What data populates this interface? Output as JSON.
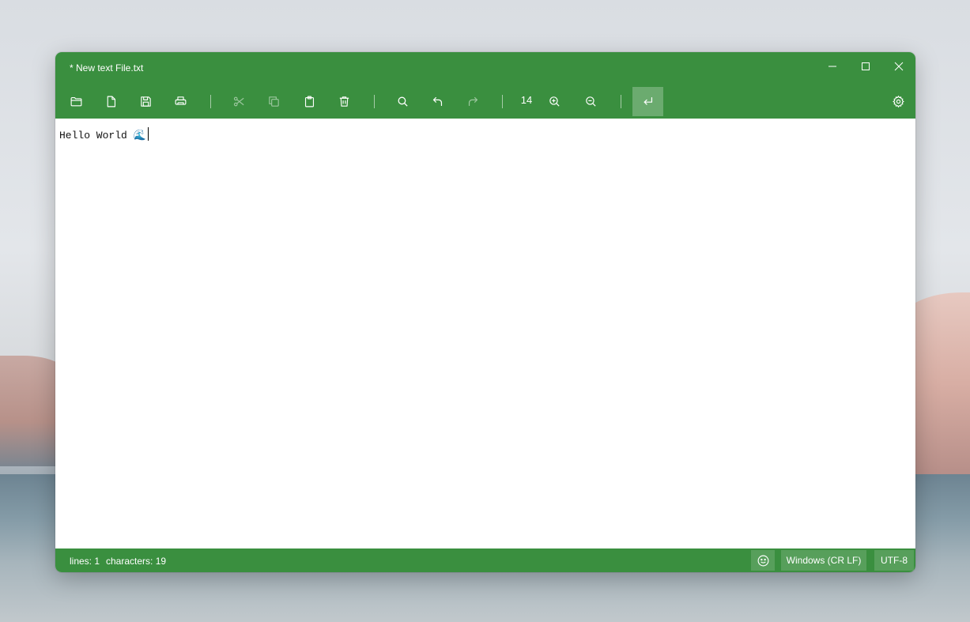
{
  "window": {
    "title": "* New text File.txt"
  },
  "toolbar": {
    "icons": [
      "open-folder-icon",
      "new-file-icon",
      "save-icon",
      "print-icon",
      "cut-icon",
      "copy-icon",
      "paste-icon",
      "delete-icon",
      "search-icon",
      "undo-icon",
      "redo-icon",
      "zoom-in-icon",
      "zoom-out-icon",
      "word-wrap-icon",
      "settings-icon"
    ],
    "font_size": "14"
  },
  "editor": {
    "content": "Hello World 🌊"
  },
  "status": {
    "lines": "lines: 1",
    "characters": "characters: 19",
    "line_ending": "Windows (CR LF)",
    "encoding": "UTF-8"
  },
  "colors": {
    "accent": "#3a8f3f",
    "text": "#ffffff"
  }
}
